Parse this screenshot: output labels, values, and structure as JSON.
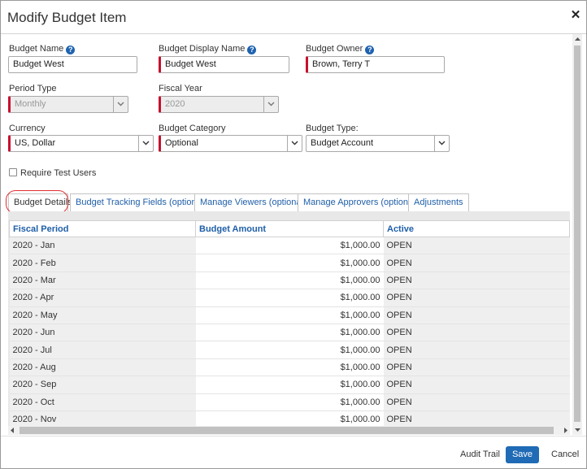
{
  "dialog": {
    "title": "Modify Budget Item",
    "close_glyph": "✕"
  },
  "fields": {
    "budget_name": {
      "label": "Budget Name",
      "value": "Budget West"
    },
    "budget_display_name": {
      "label": "Budget Display Name",
      "value": "Budget West"
    },
    "budget_owner": {
      "label": "Budget Owner",
      "value": "Brown, Terry T"
    },
    "period_type": {
      "label": "Period Type",
      "value": "Monthly"
    },
    "fiscal_year": {
      "label": "Fiscal Year",
      "value": "2020"
    },
    "currency": {
      "label": "Currency",
      "value": "US, Dollar"
    },
    "budget_category": {
      "label": "Budget Category",
      "value": "Optional"
    },
    "budget_type": {
      "label": "Budget Type:",
      "value": "Budget Account"
    },
    "require_test_users": {
      "label": "Require Test Users",
      "checked": false
    }
  },
  "tabs": [
    {
      "label": "Budget Details"
    },
    {
      "label": "Budget Tracking Fields (optional)"
    },
    {
      "label": "Manage Viewers (optional)"
    },
    {
      "label": "Manage Approvers (optional)"
    },
    {
      "label": "Adjustments"
    }
  ],
  "grid": {
    "columns": [
      "Fiscal Period",
      "Budget Amount",
      "Active"
    ],
    "rows": [
      [
        "2020 - Jan",
        "$1,000.00",
        "OPEN"
      ],
      [
        "2020 - Feb",
        "$1,000.00",
        "OPEN"
      ],
      [
        "2020 - Mar",
        "$1,000.00",
        "OPEN"
      ],
      [
        "2020 - Apr",
        "$1,000.00",
        "OPEN"
      ],
      [
        "2020 - May",
        "$1,000.00",
        "OPEN"
      ],
      [
        "2020 - Jun",
        "$1,000.00",
        "OPEN"
      ],
      [
        "2020 - Jul",
        "$1,000.00",
        "OPEN"
      ],
      [
        "2020 - Aug",
        "$1,000.00",
        "OPEN"
      ],
      [
        "2020 - Sep",
        "$1,000.00",
        "OPEN"
      ],
      [
        "2020 - Oct",
        "$1,000.00",
        "OPEN"
      ],
      [
        "2020 - Nov",
        "$1,000.00",
        "OPEN"
      ]
    ]
  },
  "footer": {
    "audit_trail": "Audit Trail",
    "save": "Save",
    "cancel": "Cancel"
  },
  "colors": {
    "accent": "#1f6bb5",
    "required": "#c8102e",
    "highlight": "#e0302f",
    "link": "#1f5fa8"
  }
}
